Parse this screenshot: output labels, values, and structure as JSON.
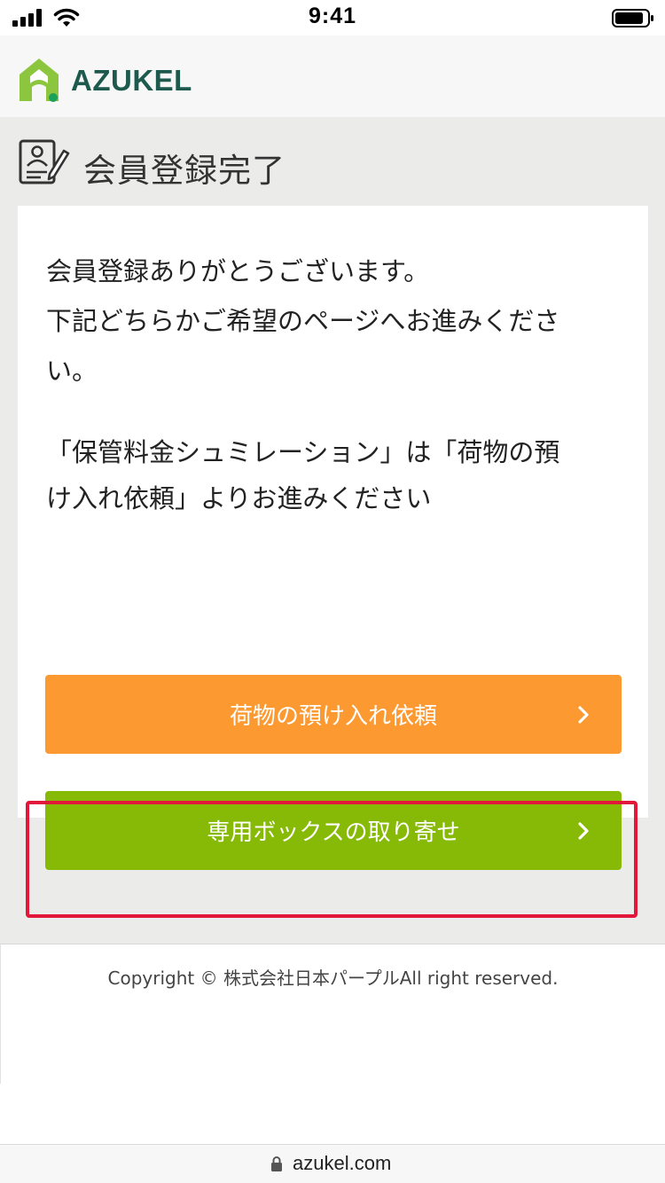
{
  "status_bar": {
    "time": "9:41",
    "icons": [
      "cellular-signal-icon",
      "wifi-icon",
      "battery-icon"
    ]
  },
  "header": {
    "logo_text": "AZUKEL",
    "logo_icon": "house-logo-icon"
  },
  "page": {
    "title": "会員登録完了",
    "title_icon": "registration-form-icon"
  },
  "message": {
    "line1": "会員登録ありがとうございます。",
    "line2": "下記どちらかご希望のページへお進みくださ",
    "line3": "い。",
    "note_line1": "「保管料金シュミレーション」は「荷物の預",
    "note_line2": "け入れ依頼」よりお進みください"
  },
  "buttons": {
    "deposit_request": "荷物の預け入れ依頼",
    "order_box": "専用ボックスの取り寄せ"
  },
  "footer": {
    "copyright": "Copyright © 株式会社日本パープルAll right reserved."
  },
  "browser": {
    "url": "azukel.com"
  },
  "colors": {
    "orange_button": "#fc9931",
    "green_button": "#87ba07",
    "highlight_border": "#e2183a",
    "logo_text": "#1d5a4d",
    "logo_green": "#8cc63f"
  }
}
